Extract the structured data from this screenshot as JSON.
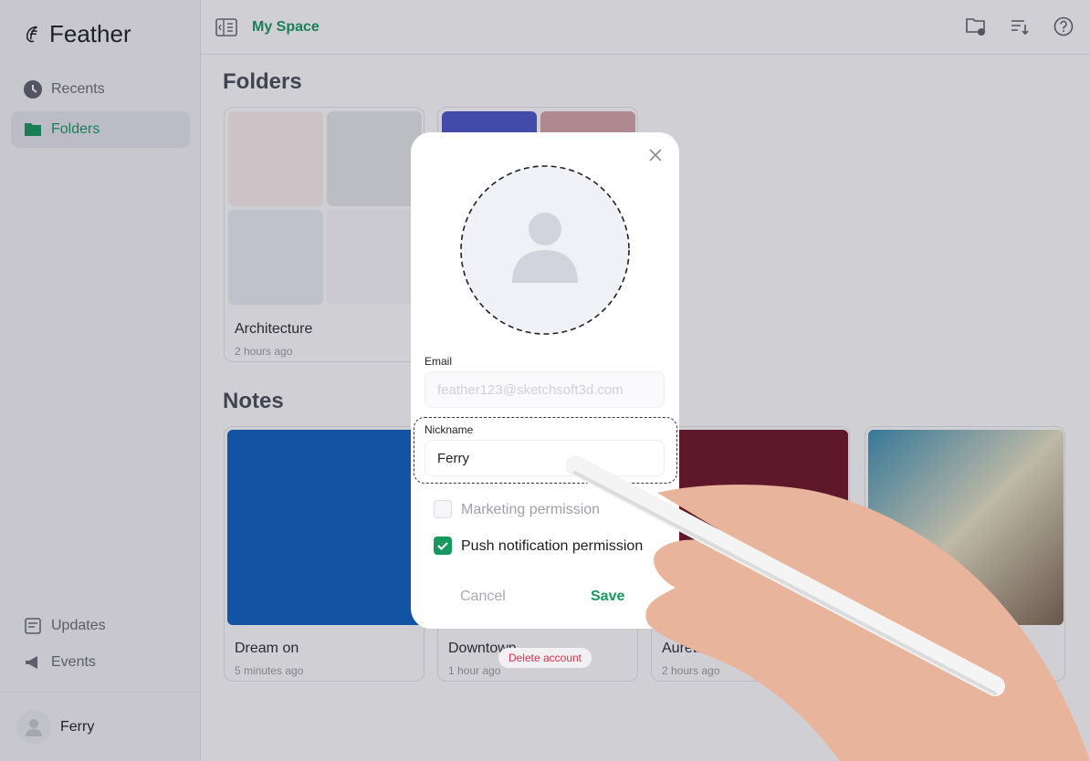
{
  "app": {
    "name": "Feather"
  },
  "sidebar": {
    "items": [
      {
        "label": "Recents",
        "icon": "clock-icon"
      },
      {
        "label": "Folders",
        "icon": "folder-icon",
        "active": true
      }
    ],
    "bottom_items": [
      {
        "label": "Updates",
        "icon": "updates-icon"
      },
      {
        "label": "Events",
        "icon": "megaphone-icon"
      }
    ],
    "user": {
      "name": "Ferry"
    }
  },
  "header": {
    "breadcrumb": "My Space",
    "icons": [
      "new-folder-icon",
      "sort-icon",
      "help-icon"
    ]
  },
  "folders": {
    "title": "Folders",
    "items": [
      {
        "title": "Architecture",
        "time": "2 hours ago"
      },
      {
        "title": "",
        "time": ""
      }
    ]
  },
  "notes": {
    "title": "Notes",
    "items": [
      {
        "title": "Dream on",
        "time": "5 minutes ago"
      },
      {
        "title": "Downtown",
        "time": "1 hour ago"
      },
      {
        "title": "Auretta C.L",
        "time": "2 hours ago"
      },
      {
        "title": "",
        "time": ""
      }
    ]
  },
  "delete_account": "Delete account",
  "modal": {
    "email_label": "Email",
    "email_placeholder": "feather123@sketchsoft3d.com",
    "nickname_label": "Nickname",
    "nickname_value": "Ferry",
    "marketing_label": "Marketing permission",
    "marketing_checked": false,
    "push_label": "Push notification permission",
    "push_checked": true,
    "cancel": "Cancel",
    "save": "Save"
  },
  "colors": {
    "accent": "#16985f",
    "danger": "#c43a4e"
  }
}
